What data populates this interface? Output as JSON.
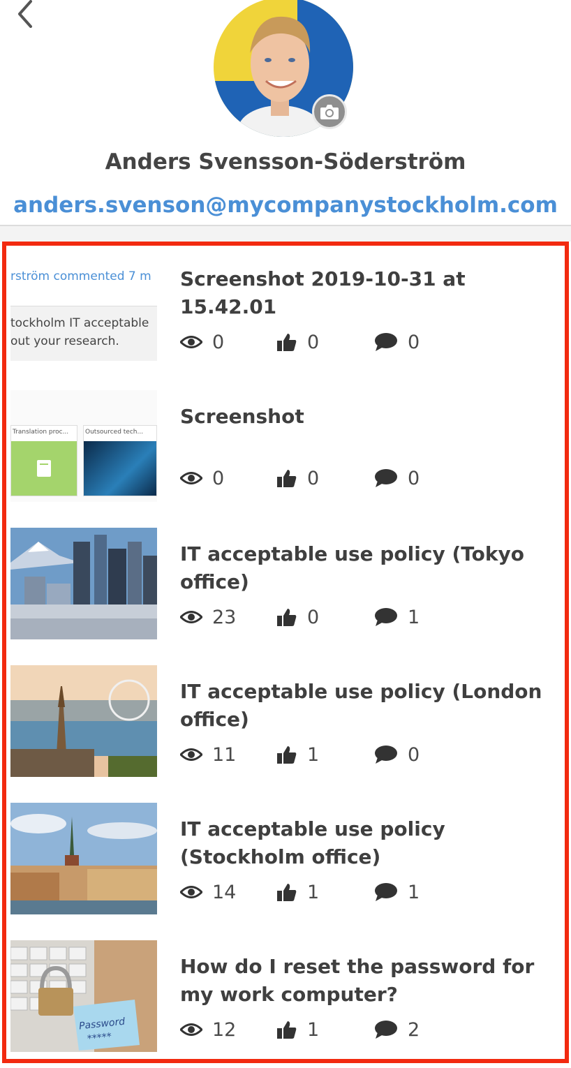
{
  "profile": {
    "name": "Anders Svensson-Söderström",
    "email": "anders.svenson@mycompanystockholm.com",
    "flag_colors": {
      "blue": "#1f63b5",
      "yellow": "#f0d43a"
    }
  },
  "items": [
    {
      "title": "Screenshot 2019-10-31 at 15.42.01",
      "views": "0",
      "likes": "0",
      "comments": "0",
      "thumb": {
        "line1": "rström commented 7 m",
        "line2": "tockholm IT acceptable",
        "line3": "out your research."
      }
    },
    {
      "title": "Screenshot",
      "views": "0",
      "likes": "0",
      "comments": "0",
      "thumb": {
        "card1": "Translation proc...",
        "card2": "Outsourced tech..."
      }
    },
    {
      "title": "IT acceptable use policy (Tokyo office)",
      "views": "23",
      "likes": "0",
      "comments": "1"
    },
    {
      "title": "IT acceptable use policy (London office)",
      "views": "11",
      "likes": "1",
      "comments": "0"
    },
    {
      "title": "IT acceptable use policy (Stockholm office)",
      "views": "14",
      "likes": "1",
      "comments": "1"
    },
    {
      "title": "How do I reset the password for my work computer?",
      "views": "12",
      "likes": "1",
      "comments": "2",
      "thumb": {
        "note": "Password",
        "stars": "*****"
      }
    }
  ],
  "colors": {
    "accent": "#4a8fd6",
    "highlight": "#f22a10"
  }
}
